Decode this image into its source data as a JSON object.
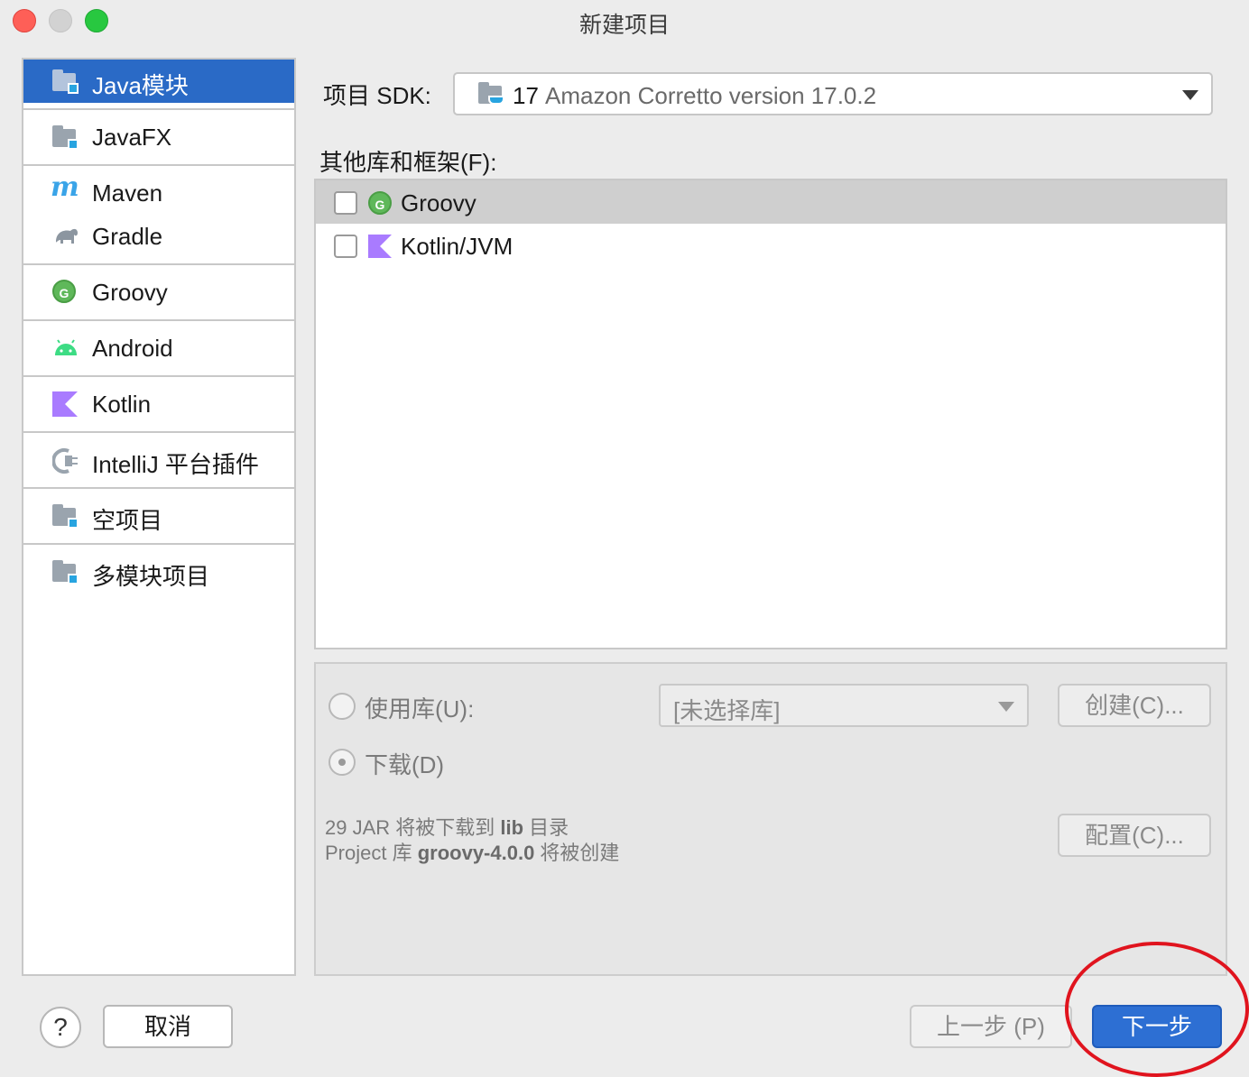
{
  "window": {
    "title": "新建项目"
  },
  "sidebar": {
    "items": [
      {
        "label": "Java模块",
        "icon": "folder-module-icon"
      },
      {
        "label": "JavaFX",
        "icon": "folder-module-icon"
      },
      {
        "label": "Maven",
        "icon": "maven-icon"
      },
      {
        "label": "Gradle",
        "icon": "gradle-elephant-icon"
      },
      {
        "label": "Groovy",
        "icon": "groovy-icon"
      },
      {
        "label": "Android",
        "icon": "android-icon"
      },
      {
        "label": "Kotlin",
        "icon": "kotlin-icon"
      },
      {
        "label": "IntelliJ 平台插件",
        "icon": "plugin-icon"
      },
      {
        "label": "空项目",
        "icon": "folder-module-icon"
      },
      {
        "label": "多模块项目",
        "icon": "folder-module-icon"
      }
    ]
  },
  "sdk": {
    "label": "项目 SDK:",
    "version_num": "17",
    "value": "Amazon Corretto version 17.0.2"
  },
  "frameworks": {
    "label": "其他库和框架(F):",
    "items": [
      {
        "label": "Groovy",
        "checked": false,
        "icon": "groovy-icon"
      },
      {
        "label": "Kotlin/JVM",
        "checked": false,
        "icon": "kotlin-icon"
      }
    ]
  },
  "library": {
    "use_label": "使用库(U):",
    "use_value": "[未选择库]",
    "create_button": "创建(C)...",
    "download_label": "下载(D)",
    "configure_button": "配置(C)...",
    "info_line1_prefix": "29 JAR 将被下载到 ",
    "info_line1_bold": "lib",
    "info_line1_suffix": " 目录",
    "info_line2_prefix": "Project 库 ",
    "info_line2_bold": "groovy-4.0.0",
    "info_line2_suffix": " 将被创建"
  },
  "footer": {
    "help": "?",
    "cancel": "取消",
    "previous": "上一步 (P)",
    "next": "下一步"
  },
  "colors": {
    "accent": "#2d6fd3",
    "annotation": "#e0141e",
    "selection": "#2a6ac6"
  }
}
